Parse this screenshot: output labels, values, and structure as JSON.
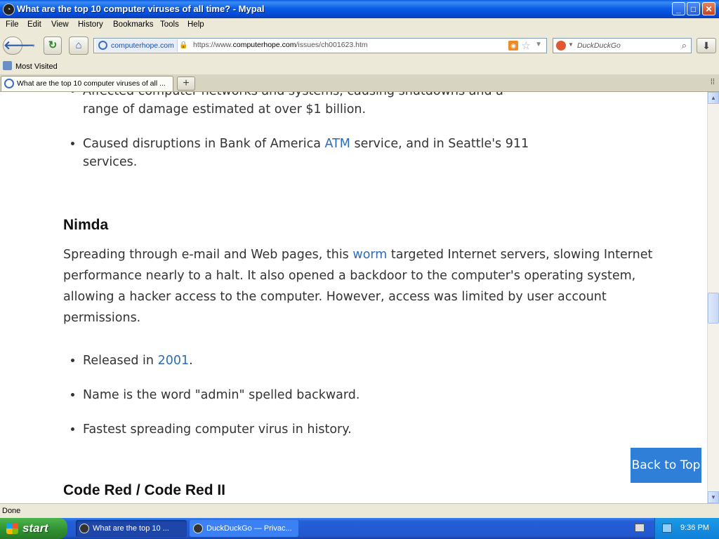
{
  "window": {
    "title": "What are the top 10 computer viruses of all time? - Mypal",
    "app_icon": "raccoon-icon",
    "buttons": {
      "minimize": "_",
      "maximize": "□",
      "close": "✕"
    }
  },
  "menu": [
    "File",
    "Edit",
    "View",
    "History",
    "Bookmarks",
    "Tools",
    "Help"
  ],
  "navbar": {
    "identity": "computerhope.com",
    "url_prefix": "https://www.",
    "url_host": "computerhope.com",
    "url_path": "/issues/ch001623.htm",
    "search_placeholder": "DuckDuckGo"
  },
  "bookmarks": {
    "most_visited": "Most Visited"
  },
  "tabs": [
    {
      "label": "What are the top 10 computer viruses of all ..."
    }
  ],
  "content": {
    "prev_items": [
      "Affected computer networks and systems, causing shutdowns and a range of damage estimated at over $1 billion."
    ],
    "prev_item2": {
      "before": "Caused disruptions in Bank of America ",
      "link": "ATM",
      "after": " service, and in Seattle's 911 services."
    },
    "nimda": {
      "heading": "Nimda",
      "para_before": "Spreading through e-mail and Web pages, this ",
      "para_link": "worm",
      "para_after": " targeted Internet servers, slowing Internet performance nearly to a halt. It also opened a backdoor to the computer's operating system, allowing a hacker access to the computer. However, access was limited by user account permissions.",
      "released_before": "Released in ",
      "released_link": "2001",
      "released_after": ".",
      "item2": "Name is the word \"admin\" spelled backward.",
      "item3": "Fastest spreading computer virus in history."
    },
    "next_heading": "Code Red / Code Red II",
    "back_to_top": "Back to Top"
  },
  "status": "Done",
  "taskbar": {
    "start": "start",
    "tasks": [
      "What are the top 10 ...",
      "DuckDuckGo — Privac..."
    ],
    "clock": "9:36 PM"
  },
  "colors": {
    "link": "#2a6cb8",
    "back_to_top": "#2f7ed8",
    "taskbar": "#2157d0"
  }
}
